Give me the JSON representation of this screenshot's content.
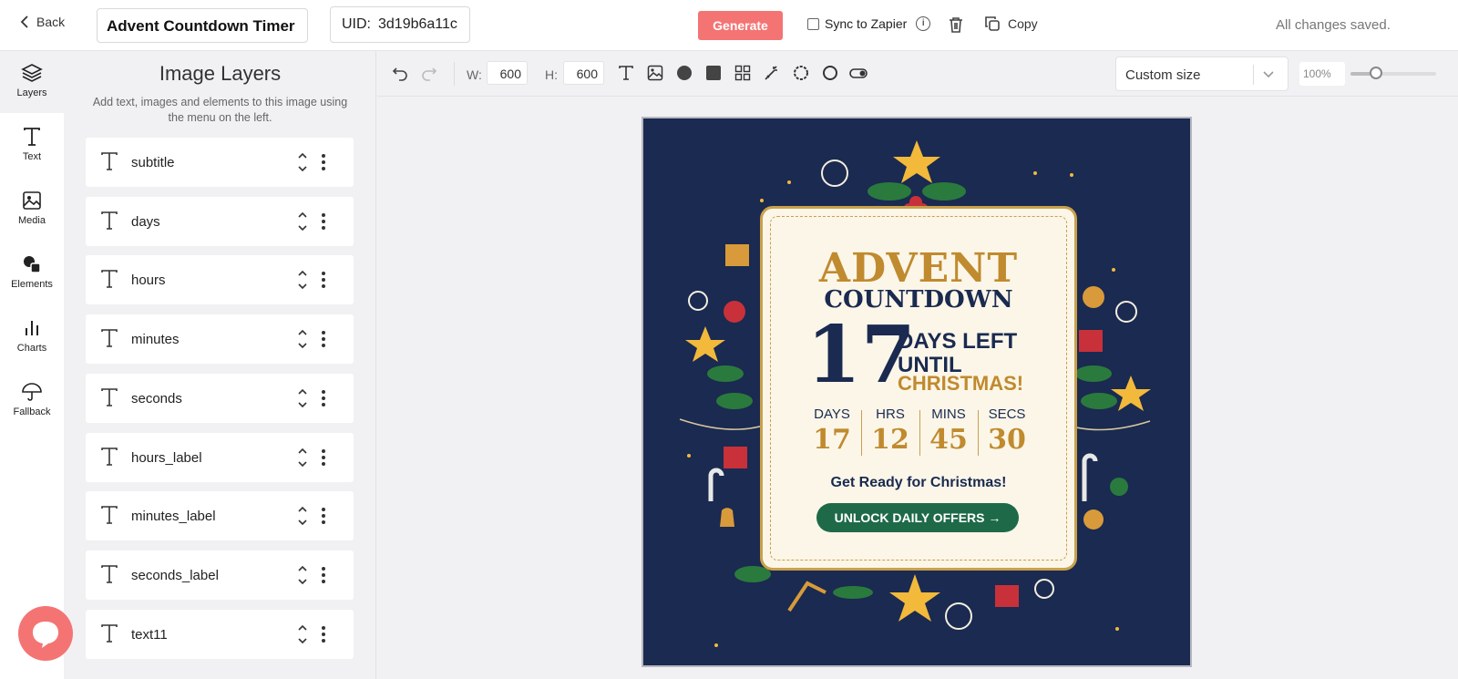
{
  "topbar": {
    "back_label": "Back",
    "title": "Advent Countdown Timer",
    "uid_label": "UID:",
    "uid_value": "3d19b6a11c",
    "generate_label": "Generate",
    "sync_label": "Sync to Zapier",
    "sync_checked": false,
    "copy_label": "Copy",
    "status": "All changes saved."
  },
  "rail": {
    "items": [
      {
        "label": "Layers",
        "icon": "layers-icon"
      },
      {
        "label": "Text",
        "icon": "text-icon"
      },
      {
        "label": "Media",
        "icon": "image-icon"
      },
      {
        "label": "Elements",
        "icon": "shapes-icon"
      },
      {
        "label": "Charts",
        "icon": "bar-chart-icon"
      },
      {
        "label": "Fallback",
        "icon": "umbrella-icon"
      }
    ]
  },
  "panel": {
    "title": "Image Layers",
    "hint": "Add text, images and elements to this image using the menu on the left.",
    "layers": [
      {
        "name": "subtitle"
      },
      {
        "name": "days"
      },
      {
        "name": "hours"
      },
      {
        "name": "minutes"
      },
      {
        "name": "seconds"
      },
      {
        "name": "hours_label"
      },
      {
        "name": "minutes_label"
      },
      {
        "name": "seconds_label"
      },
      {
        "name": "text11"
      }
    ]
  },
  "toolbar": {
    "width_label": "W:",
    "width_value": "600",
    "height_label": "H:",
    "height_value": "600",
    "size_preset": "Custom size",
    "zoom": "100%",
    "zoom_fraction": 0.3
  },
  "canvas": {
    "heading": "ADVENT",
    "subheading": "COUNTDOWN",
    "big_number": "17",
    "days_left_line1": "DAYS LEFT",
    "days_left_line2": "UNTIL",
    "days_left_line3": "CHRISTMAS!",
    "cells": [
      {
        "label": "DAYS",
        "value": "17"
      },
      {
        "label": "HRS",
        "value": "12"
      },
      {
        "label": "MINS",
        "value": "45"
      },
      {
        "label": "SECS",
        "value": "30"
      }
    ],
    "tagline": "Get Ready for Christmas!",
    "cta": "UNLOCK DAILY OFFERS →"
  },
  "colors": {
    "accent": "#f47474",
    "navy": "#1a2a50",
    "gold": "#c08a2e",
    "green": "#1e6a48"
  }
}
